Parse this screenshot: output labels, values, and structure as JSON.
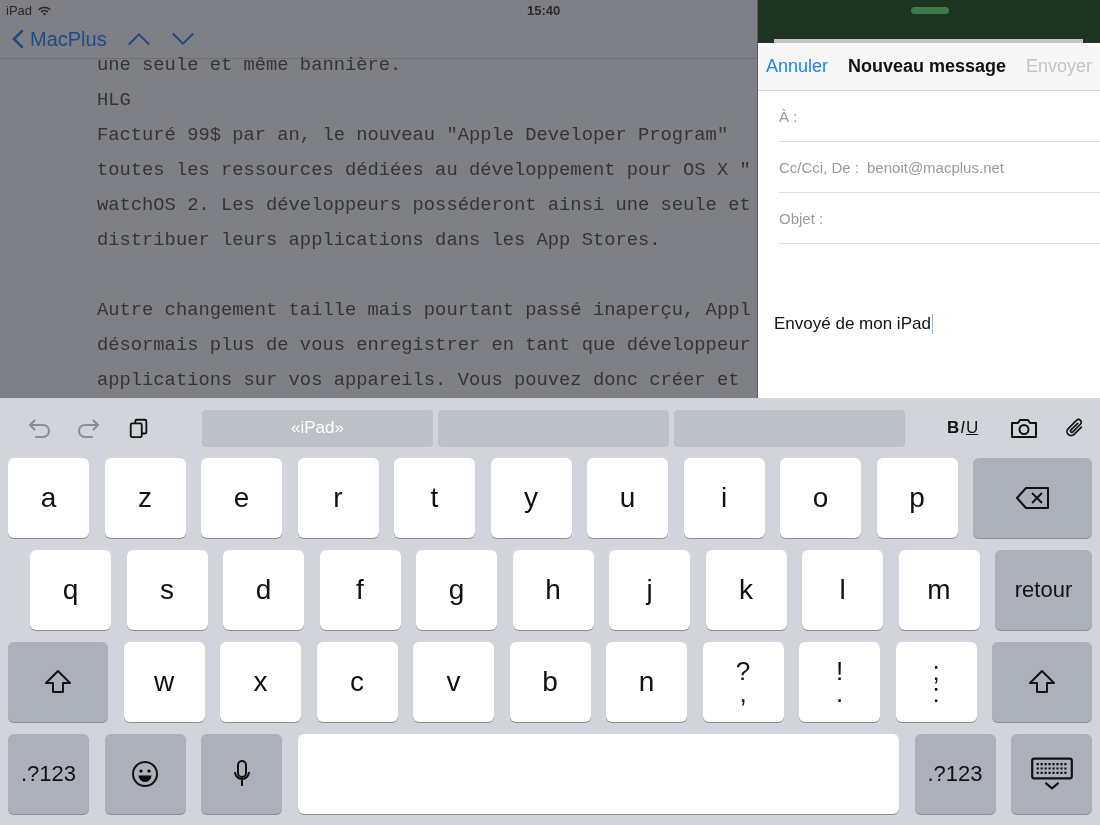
{
  "status_bar": {
    "device": "iPad",
    "time": "15:40"
  },
  "notes": {
    "back_label": "MacPlus",
    "paragraphs": [
      [
        "une seule et même bannière.",
        "HLG",
        "Facturé 99$ par an, le nouveau \"Apple Developer Program\"",
        "toutes les ressources dédiées au développement pour OS X \"",
        "watchOS 2. Les développeurs posséderont ainsi une seule et",
        "distribuer leurs applications dans les App Stores."
      ],
      [
        "Autre changement taille mais pourtant passé inaperçu, Appl",
        "désormais plus de vous enregistrer en tant que développeur",
        "applications sur vos appareils. Vous pouvez donc créer et"
      ]
    ]
  },
  "compose": {
    "cancel": "Annuler",
    "title": "Nouveau message",
    "send": {
      "label": "Envoyer",
      "disabled": true
    },
    "fields": [
      {
        "label": "À :"
      },
      {
        "label": "Cc/Cci, De :",
        "value": "benoit@macplus.net"
      },
      {
        "label": "Objet :"
      }
    ],
    "signature": "Envoyé de mon iPad"
  },
  "keyboard": {
    "suggestions": [
      "«iPad»"
    ],
    "format": {
      "bold": "B",
      "italic": "I",
      "underline": "U"
    },
    "rows": [
      {
        "keys": [
          {
            "kind": "letter",
            "label": "a"
          },
          {
            "kind": "letter",
            "label": "z"
          },
          {
            "kind": "letter",
            "label": "e"
          },
          {
            "kind": "letter",
            "label": "r"
          },
          {
            "kind": "letter",
            "label": "t"
          },
          {
            "kind": "letter",
            "label": "y"
          },
          {
            "kind": "letter",
            "label": "u"
          },
          {
            "kind": "letter",
            "label": "i"
          },
          {
            "kind": "letter",
            "label": "o"
          },
          {
            "kind": "letter",
            "label": "p"
          },
          {
            "kind": "delete"
          }
        ]
      },
      {
        "keys": [
          {
            "kind": "letter",
            "label": "q"
          },
          {
            "kind": "letter",
            "label": "s"
          },
          {
            "kind": "letter",
            "label": "d"
          },
          {
            "kind": "letter",
            "label": "f"
          },
          {
            "kind": "letter",
            "label": "g"
          },
          {
            "kind": "letter",
            "label": "h"
          },
          {
            "kind": "letter",
            "label": "j"
          },
          {
            "kind": "letter",
            "label": "k"
          },
          {
            "kind": "letter",
            "label": "l"
          },
          {
            "kind": "letter",
            "label": "m"
          },
          {
            "kind": "action",
            "label": "retour"
          }
        ]
      },
      {
        "keys": [
          {
            "kind": "shift"
          },
          {
            "kind": "letter",
            "label": "w"
          },
          {
            "kind": "letter",
            "label": "x"
          },
          {
            "kind": "letter",
            "label": "c"
          },
          {
            "kind": "letter",
            "label": "v"
          },
          {
            "kind": "letter",
            "label": "b"
          },
          {
            "kind": "letter",
            "label": "n"
          },
          {
            "kind": "dual",
            "label": "?",
            "sublabel": ","
          },
          {
            "kind": "dual",
            "label": "!",
            "sublabel": "."
          },
          {
            "kind": "dual",
            "label": ";",
            "sublabel": ":"
          },
          {
            "kind": "shift"
          }
        ]
      },
      {
        "keys": [
          {
            "kind": "action",
            "label": ".?123"
          },
          {
            "kind": "emoji"
          },
          {
            "kind": "mic"
          },
          {
            "kind": "space"
          },
          {
            "kind": "action",
            "label": ".?123"
          },
          {
            "kind": "hide"
          }
        ]
      }
    ]
  }
}
